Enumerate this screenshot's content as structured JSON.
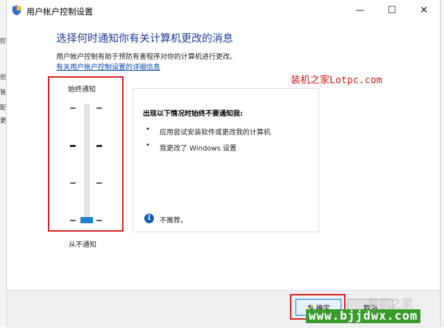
{
  "window": {
    "title": "用户帐户控制设置",
    "minimize_glyph": "—",
    "maximize_glyph": "☐",
    "close_glyph": "✕"
  },
  "background_left_chars": [
    "控",
    "",
    "创",
    "",
    "管",
    "",
    "配",
    "更"
  ],
  "main": {
    "heading": "选择何时通知你有关计算机更改的消息",
    "description": "用户帐户控制有助于预防有害程序对你的计算机进行更改。",
    "link": "有关用户帐户控制设置的详细信息"
  },
  "slider": {
    "top_label": "始终通知",
    "bottom_label": "从不通知",
    "level": 0,
    "levels": 4
  },
  "panel": {
    "title": "出现以下情况时始终不要通知我:",
    "bullets": [
      "应用尝试安装软件或更改我的计算机",
      "我更改了 Windows 设置"
    ],
    "bullet_glyph": "•",
    "info_glyph": "i",
    "info_text": "不推荐。"
  },
  "footer": {
    "ok_label": "确定",
    "cancel_label": "取消"
  },
  "watermarks": {
    "top": "装机之家Lotpc.com",
    "bottom_green": "www.bjjdwx.com",
    "bottom_gray": "技机之家"
  },
  "colors": {
    "accent_blue": "#1e3a96",
    "link_blue": "#0645ad",
    "highlight_red": "#d01919",
    "slider_thumb": "#1a7fd0"
  },
  "icons": [
    "uac-shield-icon",
    "minimize-icon",
    "maximize-icon",
    "close-icon",
    "info-icon",
    "shield-icon"
  ]
}
